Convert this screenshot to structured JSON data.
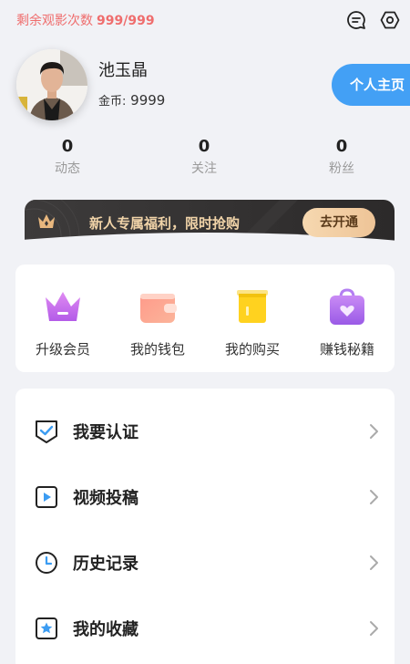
{
  "top": {
    "views_label": "剩余观影次数",
    "views_count": "999/999"
  },
  "profile": {
    "username": "池玉晶",
    "coins_label": "金币:",
    "coins_value": "9999",
    "profile_button": "个人主页"
  },
  "stats": [
    {
      "value": "0",
      "label": "动态"
    },
    {
      "value": "0",
      "label": "关注"
    },
    {
      "value": "0",
      "label": "粉丝"
    }
  ],
  "vip_banner": {
    "text": "新人专属福利，限时抢购",
    "button": "去开通"
  },
  "quick_actions": [
    {
      "label": "升级会员",
      "icon": "crown-icon"
    },
    {
      "label": "我的钱包",
      "icon": "wallet-icon"
    },
    {
      "label": "我的购买",
      "icon": "purchase-icon"
    },
    {
      "label": "赚钱秘籍",
      "icon": "gift-bag-icon"
    }
  ],
  "menu": [
    {
      "label": "我要认证",
      "icon": "shield-check-icon"
    },
    {
      "label": "视频投稿",
      "icon": "video-play-icon"
    },
    {
      "label": "历史记录",
      "icon": "clock-icon"
    },
    {
      "label": "我的收藏",
      "icon": "star-icon"
    }
  ],
  "colors": {
    "accent": "#43a0f5",
    "warning_text": "#ef6d6d",
    "vip_gold": "#f0d3a8",
    "background": "#f1f2f6"
  }
}
